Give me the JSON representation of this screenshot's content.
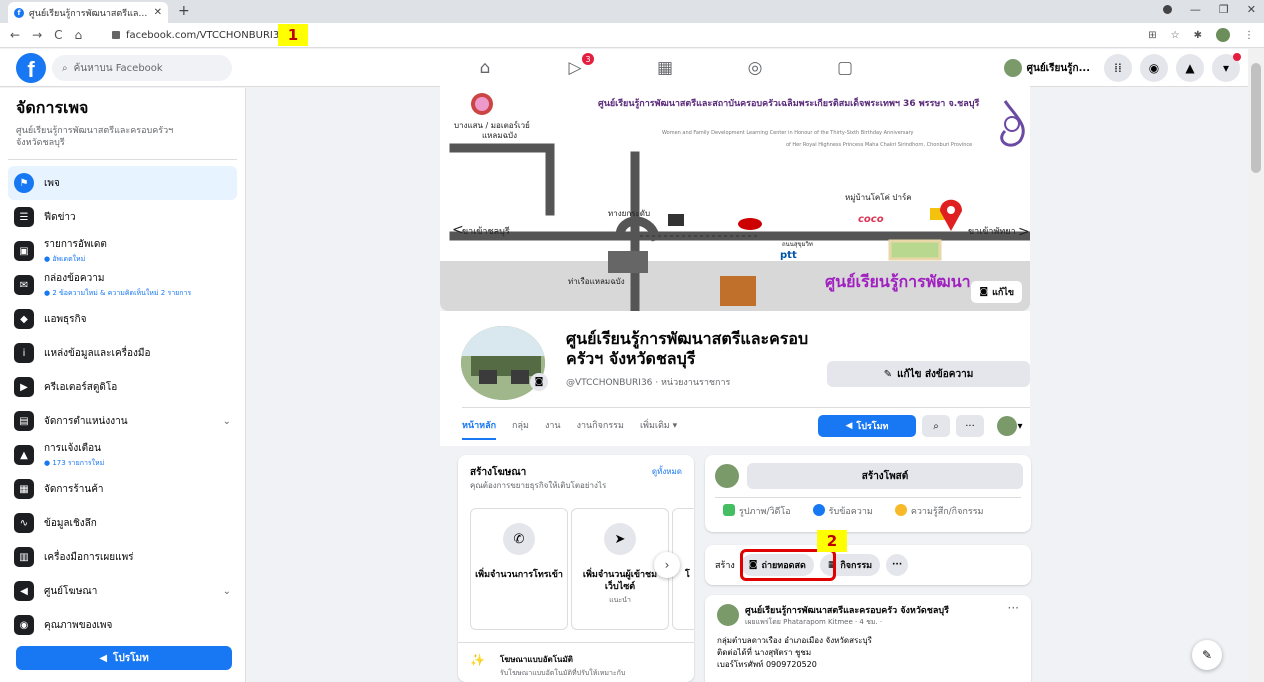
{
  "browser": {
    "tab_title": "ศูนย์เรียนรู้การพัฒนาสตรีและครอบครัว...",
    "url": "facebook.com/VTCCHONBURI36/"
  },
  "callouts": {
    "one": "1",
    "two": "2"
  },
  "fb": {
    "search_placeholder": "ค้นหาบน Facebook",
    "nav_badge": "3",
    "profile_name": "ศูนย์เรียนรู้ก..."
  },
  "sidebar": {
    "title": "จัดการเพจ",
    "subtitle": "ศูนย์เรียนรู้การพัฒนาสตรีและครอบครัวฯ จังหวัดชลบุรี",
    "items": [
      {
        "label": "เพจ",
        "sub": "",
        "icon": "flag-icon",
        "glyph": "⚑"
      },
      {
        "label": "ฟีดข่าว",
        "sub": "",
        "icon": "feed-icon",
        "glyph": "☰"
      },
      {
        "label": "รายการอัพเดต",
        "sub": "● อัพเดตใหม่",
        "icon": "updates-icon",
        "glyph": "▣"
      },
      {
        "label": "กล่องข้อความ",
        "sub": "● 2 ข้อความใหม่ & ความคิดเห็นใหม่ 2 รายการ",
        "icon": "inbox-icon",
        "glyph": "✉"
      },
      {
        "label": "แอพธุรกิจ",
        "sub": "",
        "icon": "cube-icon",
        "glyph": "◆"
      },
      {
        "label": "แหล่งข้อมูลและเครื่องมือ",
        "sub": "",
        "icon": "info-icon",
        "glyph": "i"
      },
      {
        "label": "ครีเอเตอร์สตูดิโอ",
        "sub": "",
        "icon": "studio-icon",
        "glyph": "▶"
      },
      {
        "label": "จัดการตำแหน่งงาน",
        "sub": "",
        "icon": "briefcase-icon",
        "glyph": "▤"
      },
      {
        "label": "การแจ้งเตือน",
        "sub": "● 173 รายการใหม่",
        "icon": "bell-icon",
        "glyph": "▲"
      },
      {
        "label": "จัดการร้านค้า",
        "sub": "",
        "icon": "shop-icon",
        "glyph": "▦"
      },
      {
        "label": "ข้อมูลเชิงลึก",
        "sub": "",
        "icon": "insights-icon",
        "glyph": "∿"
      },
      {
        "label": "เครื่องมือการเผยแพร่",
        "sub": "",
        "icon": "publish-icon",
        "glyph": "▥"
      },
      {
        "label": "ศูนย์โฆษณา",
        "sub": "",
        "icon": "megaphone-icon",
        "glyph": "◀"
      },
      {
        "label": "คุณภาพของเพจ",
        "sub": "",
        "icon": "quality-icon",
        "glyph": "◉"
      }
    ],
    "promote_label": "โปรโมท"
  },
  "cover": {
    "edit_label": "แก้ไข",
    "header_th": "ศูนย์เรียนรู้การพัฒนาสตรีและสถาบันครอบครัวเฉลิมพระเกียรติสมเด็จพระเทพฯ 36 พรรษา จ.ชลบุรี",
    "header_en1": "Women and Family Development Learning Center in Honour of the Thirty-Sixth Birthday Anniversary",
    "header_en2": "of Her Royal Highness Princess Maha Chakri Sirindhorn, Chonburi Province",
    "map_labels": {
      "bangsaen": "บางแสน / มอเตอร์เวย์",
      "laemchabang": "แหลมฉบัง",
      "to_chonburi": "ขาเข้าชลบุรี",
      "to_pattaya": "ขาเข้าพัทยา",
      "intersection": "ทางยกระดับ",
      "village": "หมู่บ้านโคโค่ ปาร์ค",
      "sukhumvit": "ถนนสุขุมวิท",
      "port": "ท่าเรือแหลมฉบัง",
      "center": "ศูนย์เรียนรู้การพัฒนา"
    }
  },
  "page": {
    "name": "ศูนย์เรียนรู้การพัฒนาสตรีและครอบครัวฯ จังหวัดชลบุรี",
    "handle": "@VTCCHONBURI36 · หน่วยงานราชการ",
    "edit_send": "แก้ไข ส่งข้อความ",
    "tabs": [
      "หน้าหลัก",
      "กลุ่ม",
      "งาน",
      "งานกิจกรรม",
      "เพิ่มเติม ▾"
    ],
    "promote": "โปรโมท"
  },
  "ads": {
    "title": "สร้างโฆษณา",
    "see_all": "ดูทั้งหมด",
    "subtitle": "คุณต้องการขยายธุรกิจให้เติบโตอย่างไร",
    "cards": [
      {
        "title": "เพิ่มจำนวนการโทรเข้า",
        "sub": "",
        "icon": "phone-icon",
        "glyph": "✆"
      },
      {
        "title": "เพิ่มจำนวนผู้เข้าชมเว็บไซต์",
        "sub": "แนะนำ",
        "icon": "cursor-icon",
        "glyph": "➤"
      },
      {
        "title": "โ",
        "sub": "",
        "icon": "",
        "glyph": ""
      }
    ],
    "auto_title": "โฆษณาแบบอัตโนมัติ",
    "auto_sub": "รับโฆษณาแบบอัตโนมัติที่ปรับให้เหมาะกับ"
  },
  "composer": {
    "create_post": "สร้างโพสต์",
    "actions": [
      "รูปภาพ/วิดีโอ",
      "รับข้อความ",
      "ความรู้สึก/กิจกรรม"
    ],
    "create_label": "สร้าง",
    "live_label": "ถ่ายทอดสด",
    "event_label": "กิจกรรม"
  },
  "post": {
    "author": "ศูนย์เรียนรู้การพัฒนาสตรีและครอบครัว จังหวัดชลบุรี",
    "by": "เผยแพร่โดย Phatarapom Kitmee · 4 ชม. ·",
    "line1": "กลุ่มตำบลดาวเรือง อำเภอเมือง จังหวัดสระบุรี",
    "line2": "ติดต่อได้ที่ นางสุพัตรา ชูชม",
    "line3": "เบอร์โทรศัพท์ 0909720520"
  },
  "colors": {
    "fb_blue": "#1877f2",
    "callout_yellow": "#ffff00",
    "highlight_red": "#e00000"
  }
}
